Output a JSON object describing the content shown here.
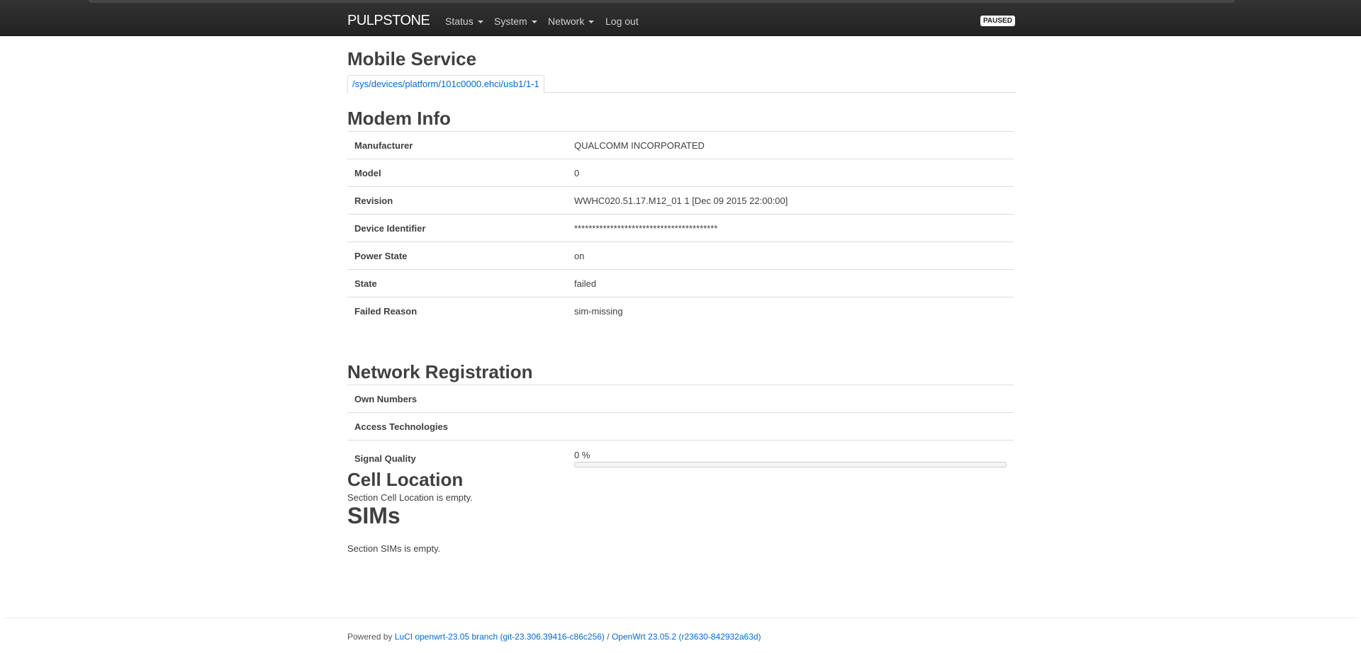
{
  "header": {
    "brand": "PULPSTONE",
    "menu": [
      {
        "label": "Status",
        "has_dropdown": true
      },
      {
        "label": "System",
        "has_dropdown": true
      },
      {
        "label": "Network",
        "has_dropdown": true
      },
      {
        "label": "Log out",
        "has_dropdown": false
      }
    ],
    "paused_badge": "PAUSED"
  },
  "page": {
    "title": "Mobile Service",
    "tab_label": "/sys/devices/platform/101c0000.ehci/usb1/1-1"
  },
  "modem_info": {
    "title": "Modem Info",
    "rows": [
      {
        "key": "Manufacturer",
        "value": "QUALCOMM INCORPORATED"
      },
      {
        "key": "Model",
        "value": "0"
      },
      {
        "key": "Revision",
        "value": "WWHC020.51.17.M12_01 1 [Dec 09 2015 22:00:00]"
      },
      {
        "key": "Device Identifier",
        "value": "****************************************"
      },
      {
        "key": "Power State",
        "value": "on"
      },
      {
        "key": "State",
        "value": "failed"
      },
      {
        "key": "Failed Reason",
        "value": "sim-missing"
      }
    ]
  },
  "network_registration": {
    "title": "Network Registration",
    "own_numbers_label": "Own Numbers",
    "own_numbers_value": "",
    "access_tech_label": "Access Technologies",
    "access_tech_value": "",
    "signal_label": "Signal Quality",
    "signal_text": "0 %",
    "signal_percent": 0
  },
  "cell_location": {
    "title": "Cell Location",
    "empty_text": "Section Cell Location is empty."
  },
  "sims": {
    "title": "SIMs",
    "empty_text": "Section SIMs is empty."
  },
  "footer": {
    "prefix": "Powered by",
    "luci_link": "LuCI openwrt-23.05 branch (git-23.306.39416-c86c256)",
    "separator": "/",
    "openwrt_link": "OpenWrt 23.05.2 (r23630-842932a63d)"
  },
  "colors": {
    "link": "#0069d6",
    "header_bg": "#222222",
    "text": "#404040"
  }
}
